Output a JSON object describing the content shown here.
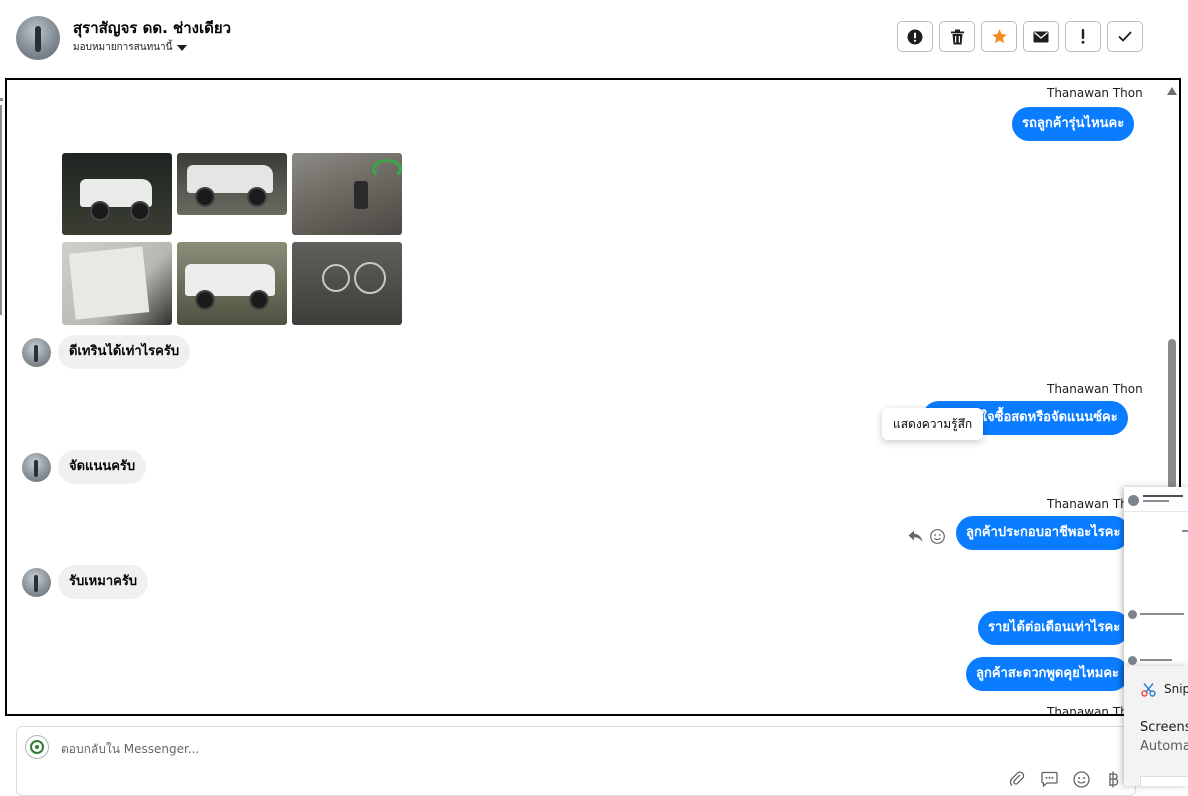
{
  "header": {
    "contact_name": "สุราสัญจร ดด. ช่างเดียว",
    "assign_label": "มอบหมายการสนทนานี้",
    "actions": [
      {
        "icon": "alert-circle-icon",
        "name": "mark-spam-button"
      },
      {
        "icon": "trash-icon",
        "name": "delete-button"
      },
      {
        "icon": "star-icon",
        "name": "star-button",
        "color": "#f28b22"
      },
      {
        "icon": "envelope-icon",
        "name": "mark-unread-button"
      },
      {
        "icon": "exclamation-icon",
        "name": "flag-button"
      },
      {
        "icon": "check-icon",
        "name": "mark-done-button"
      }
    ]
  },
  "messages": {
    "m1_sender": "Thanawan Thon",
    "m1_text": "รถลูกค้ารุ่นไหนคะ",
    "m2_text": "ดีเทรินได้เท่าไรครับ",
    "m3_sender": "Thanawan Thon",
    "m3_text": "ลูกค้าสนใจซื้อสดหรือจัดแนนซ์คะ",
    "m4_text": "จัดแนนครับ",
    "m5_sender": "Thanawan Tho",
    "m5_text": "ลูกค้าประกอบอาชีพอะไรคะ",
    "m6_text": "รับเหมาครับ",
    "m7_text": "รายได้ต่อเดือนเท่าไรคะ",
    "m8_text": "ลูกค้าสะดวกพูดคุยไหมคะ",
    "m9_sender": "Thanawan Thon"
  },
  "tooltip": {
    "text": "แสดงความรู้สึก"
  },
  "composer": {
    "placeholder": "ตอบกลับใน Messenger..."
  },
  "snip_toast": {
    "title": "Snip",
    "heading": "Screens",
    "subtext": "Automa"
  },
  "colors": {
    "outgoing_bubble": "#0a7cff",
    "incoming_bubble": "#f0f0f0",
    "star": "#f28b22"
  }
}
